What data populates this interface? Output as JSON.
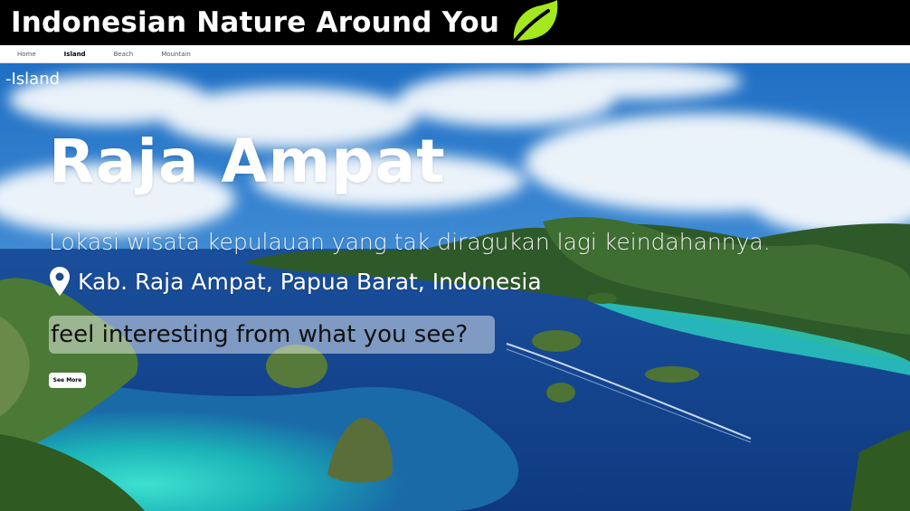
{
  "header": {
    "title": "Indonesian Nature Around You",
    "logo_icon": "leaf-icon",
    "accent": "#a4e81d"
  },
  "nav": {
    "items": [
      "Home",
      "Island",
      "Beach",
      "Mountain"
    ],
    "active": "Island"
  },
  "hero": {
    "category": "-Island",
    "title": "Raja Ampat",
    "description": "Lokasi wisata kepulauan yang tak diragukan lagi keindahannya.",
    "location_icon": "map-pin-icon",
    "location": "Kab. Raja Ampat, Papua Barat, Indonesia",
    "tagline": "feel interesting from what you see?",
    "button_label": "See More"
  }
}
